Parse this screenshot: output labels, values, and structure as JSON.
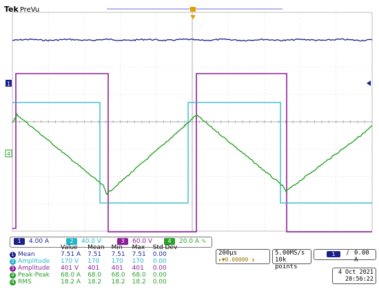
{
  "header": {
    "brand": "Tek",
    "mode": "PreVu"
  },
  "colors": {
    "ch1": "#1b1f8a",
    "ch2": "#22b8c9",
    "ch3": "#8b1f9b",
    "ch4": "#2aa02a",
    "grid": "#bdbdbd",
    "trigger": "#e0a000"
  },
  "channels": [
    {
      "num": "1",
      "scale": "4.00 A",
      "color": "#1b1f8a"
    },
    {
      "num": "2",
      "scale": "40.0 V",
      "color": "#22b8c9"
    },
    {
      "num": "3",
      "scale": "60.0 V",
      "color": "#8b1f9b"
    },
    {
      "num": "4",
      "scale": "20.0 A",
      "suffix": "∿",
      "color": "#2aa02a"
    }
  ],
  "markers": {
    "ch1": "1",
    "ch4": "4",
    "trigger": "T"
  },
  "measurements": {
    "headers": [
      "Value",
      "Mean",
      "Min",
      "Max",
      "Std Dev"
    ],
    "rows": [
      {
        "ch": "1",
        "name": "Mean",
        "value": "7.51 A",
        "mean": "7.51",
        "min": "7.51",
        "max": "7.51",
        "std": "0.00",
        "color": "#1b1f8a"
      },
      {
        "ch": "2",
        "name": "Amplitude",
        "value": "170 V",
        "mean": "170",
        "min": "170",
        "max": "170",
        "std": "0.00",
        "color": "#22b8c9"
      },
      {
        "ch": "3",
        "name": "Amplitude",
        "value": "401 V",
        "mean": "401",
        "min": "401",
        "max": "401",
        "std": "0.00",
        "color": "#8b1f9b"
      },
      {
        "ch": "4",
        "name": "Peak-Peak",
        "value": "68.0 A",
        "mean": "68.0",
        "min": "68.0",
        "max": "68.0",
        "std": "0.00",
        "color": "#2aa02a"
      },
      {
        "ch": "4",
        "name": "RMS",
        "value": "18.2 A",
        "mean": "18.2",
        "min": "18.2",
        "max": "18.2",
        "std": "0.00",
        "color": "#2aa02a"
      }
    ]
  },
  "timebase": {
    "scale": "200µs",
    "delay": "▸▼0.00000 s"
  },
  "acquisition": {
    "rate": "5.00MS/s",
    "points": "10k points"
  },
  "trigger": {
    "source": "1",
    "slope": "∕",
    "level": "0.00 A"
  },
  "datetime": {
    "date": "4 Oct  2021",
    "time": "20:56:22"
  }
}
